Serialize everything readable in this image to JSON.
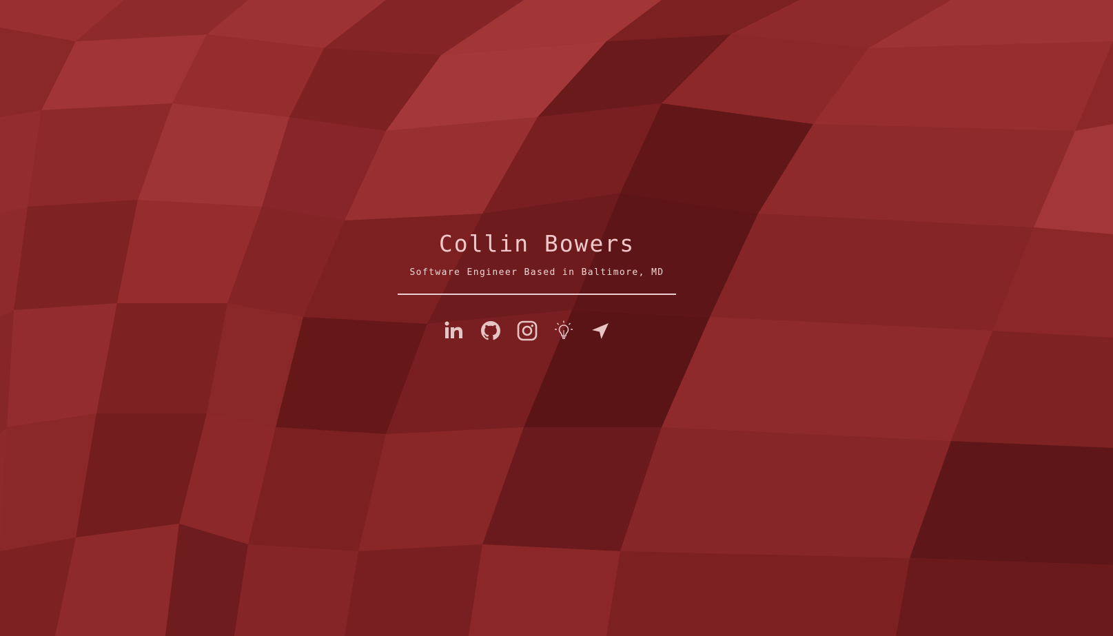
{
  "page": {
    "background_color": "#8a2628",
    "accent_color": "#e7c5c5"
  },
  "header": {
    "name": "Collin Bowers",
    "subtitle": "Software Engineer Based in Baltimore, MD"
  },
  "social_links": [
    {
      "icon": "linkedin-icon"
    },
    {
      "icon": "github-icon"
    },
    {
      "icon": "instagram-icon"
    },
    {
      "icon": "lightbulb-icon"
    },
    {
      "icon": "send-icon"
    }
  ]
}
